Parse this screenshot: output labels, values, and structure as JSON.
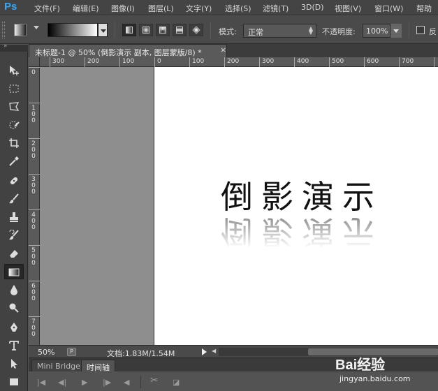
{
  "app": {
    "logo": "Ps"
  },
  "menu": [
    "文件(F)",
    "编辑(E)",
    "图像(I)",
    "图层(L)",
    "文字(Y)",
    "选择(S)",
    "滤镜(T)",
    "3D(D)",
    "视图(V)",
    "窗口(W)",
    "帮助"
  ],
  "options": {
    "mode_label": "模式:",
    "mode_value": "正常",
    "opacity_label": "不透明度:",
    "opacity_value": "100%",
    "reverse_label": "反"
  },
  "document": {
    "tab_title": "未标题-1 @ 50% (倒影演示 副本, 图层蒙版/8) *",
    "close_glyph": "×",
    "main_text": "倒影演示",
    "reflection_text": "倒影演示"
  },
  "ruler": {
    "h_labels": [
      "300",
      "200",
      "100",
      "0",
      "100",
      "200",
      "300",
      "400",
      "500",
      "600",
      "700"
    ],
    "v_labels": [
      "0",
      "100",
      "200",
      "300",
      "400",
      "500",
      "600",
      "700"
    ]
  },
  "status": {
    "zoom": "50%",
    "doc_info": "文档:1.83M/1.54M"
  },
  "bottom_tabs": [
    "Mini Bridge",
    "时间轴"
  ],
  "watermark": {
    "logo": "Bai经验",
    "url": "jingyan.baidu.com"
  }
}
